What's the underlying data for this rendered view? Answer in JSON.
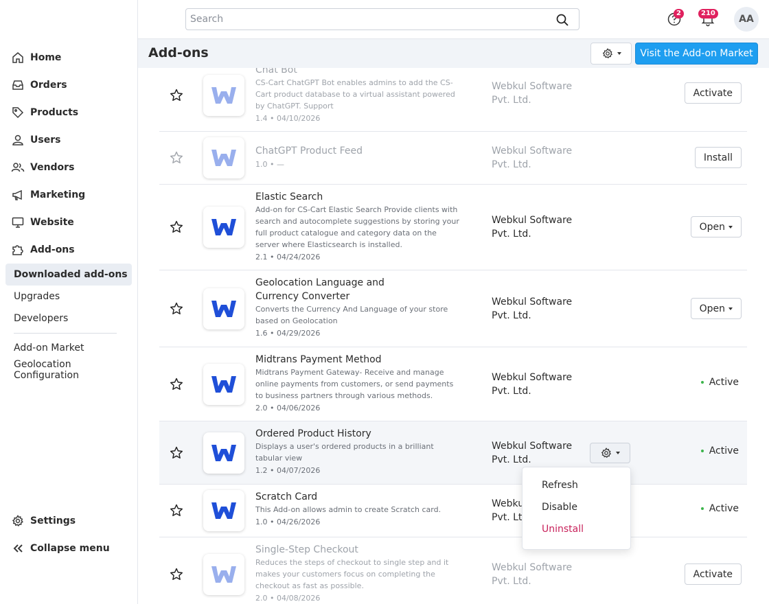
{
  "sidebar": {
    "nav": [
      {
        "label": "Home",
        "icon": "home-icon"
      },
      {
        "label": "Orders",
        "icon": "inbox-icon"
      },
      {
        "label": "Products",
        "icon": "tag-icon"
      },
      {
        "label": "Users",
        "icon": "user-icon"
      },
      {
        "label": "Vendors",
        "icon": "users-icon"
      },
      {
        "label": "Marketing",
        "icon": "megaphone-icon"
      },
      {
        "label": "Website",
        "icon": "monitor-icon"
      },
      {
        "label": "Add-ons",
        "icon": "puzzle-icon"
      }
    ],
    "sub": [
      {
        "label": "Downloaded add-ons",
        "active": true
      },
      {
        "label": "Upgrades"
      },
      {
        "label": "Developers"
      },
      {
        "label": "Add-on Market"
      },
      {
        "label": "Geolocation Configuration"
      }
    ],
    "settings_label": "Settings",
    "collapse_label": "Collapse menu"
  },
  "header": {
    "search_placeholder": "Search",
    "help_badge": "2",
    "notif_badge": "210",
    "avatar_initials": "AA"
  },
  "page": {
    "title": "Add-ons",
    "market_button": "Visit the Add-on Market"
  },
  "addons": [
    {
      "name": "Chat Bot",
      "desc": "CS-Cart ChatGPT Bot enables admins to add the CS-Cart product database to a virtual assistant powered by ChatGPT. Support",
      "meta": "1.4 • 04/10/2026",
      "vendor": "Webkul Software Pvt. Ltd.",
      "action": "Activate",
      "faded": true
    },
    {
      "name": "ChatGPT Product Feed",
      "desc": "",
      "meta": "1.0 • —",
      "vendor": "Webkul Software Pvt. Ltd.",
      "action": "Install",
      "faded": true
    },
    {
      "name": "Elastic Search",
      "desc": "Add-on for CS-Cart Elastic Search Provide clients with search and autocomplete suggestions by storing your full product catalogue and category data on the server where Elasticsearch is installed.",
      "meta": "2.1 • 04/24/2026",
      "vendor": "Webkul Software Pvt. Ltd.",
      "action": "Open"
    },
    {
      "name": "Geolocation Language and Currency Converter",
      "desc": "Converts the Currency And Language of your store based on Geolocation",
      "meta": "1.6 • 04/29/2026",
      "vendor": "Webkul Software Pvt. Ltd.",
      "action": "Open"
    },
    {
      "name": "Midtrans Payment Method",
      "desc": "Midtrans Payment Gateway- Receive and manage online payments from customers, or send payments to business partners through various methods.",
      "meta": "2.0 • 04/06/2026",
      "vendor": "Webkul Software Pvt. Ltd.",
      "status": "Active"
    },
    {
      "name": "Ordered Product History",
      "desc": "Displays a user's ordered products in a brilliant tabular view",
      "meta": "1.2 • 04/07/2026",
      "vendor": "Webkul Software Pvt. Ltd.",
      "status": "Active"
    },
    {
      "name": "Scratch Card",
      "desc": "This Add-on allows admin to create Scratch card.",
      "meta": "1.0 • 04/26/2026",
      "vendor": "Webkul Software Pvt. Ltd.",
      "status": "Active"
    },
    {
      "name": "Single-Step Checkout",
      "desc": "Reduces the steps of checkout to single step and it makes your customers focus on completing the checkout as fast as possible.",
      "meta": "2.0 • 04/08/2026",
      "vendor": "Webkul Software Pvt. Ltd.",
      "action": "Activate",
      "faded": true
    }
  ],
  "context_menu": {
    "refresh": "Refresh",
    "disable": "Disable",
    "uninstall": "Uninstall"
  },
  "colors": {
    "primary": "#1e9ef0",
    "badge": "#e0215e",
    "danger": "#c8215a",
    "active_dot": "#3cb44b",
    "logo_blue": "#1f4fd8"
  }
}
